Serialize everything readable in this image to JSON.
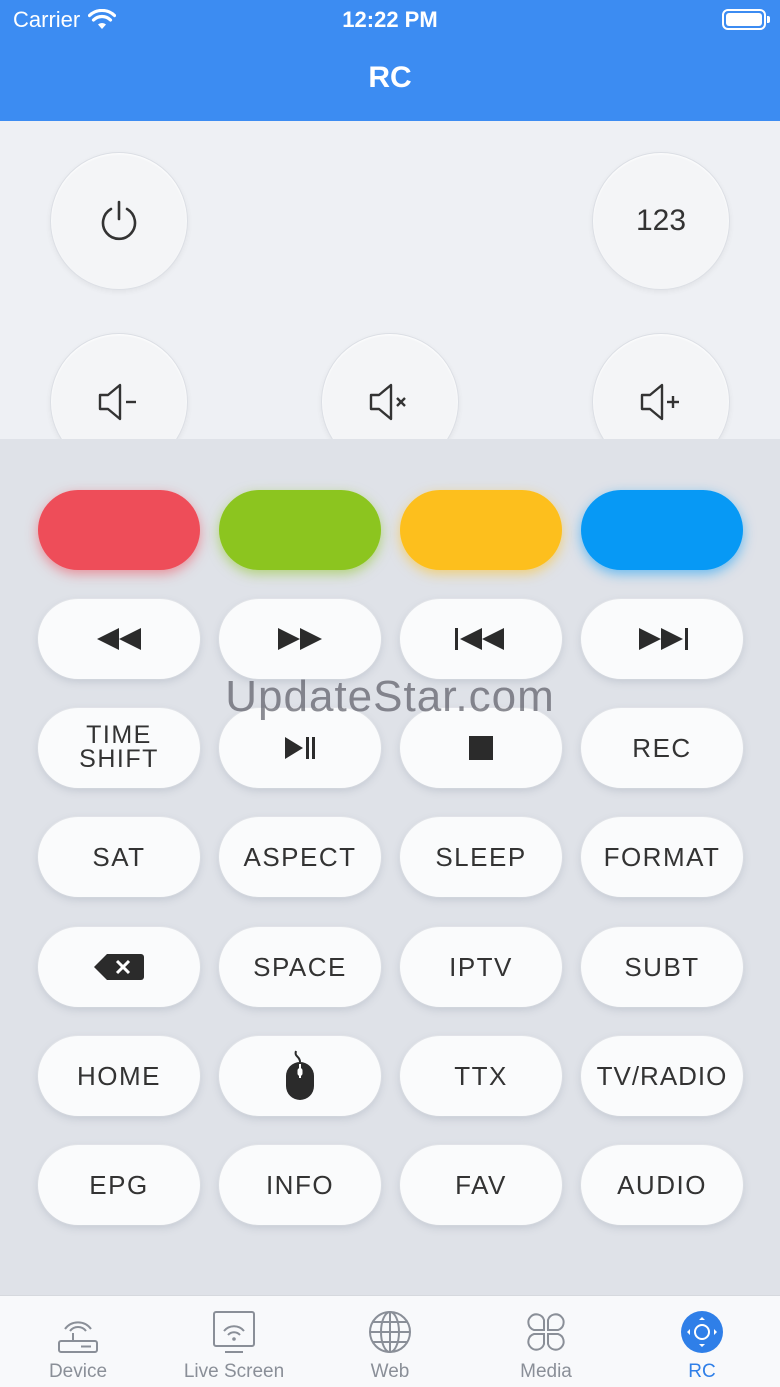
{
  "status_bar": {
    "carrier": "Carrier",
    "time": "12:22 PM"
  },
  "header": {
    "title": "RC"
  },
  "top_buttons": {
    "power_icon": "power-icon",
    "numpad_label": "123",
    "vol_down_icon": "volume-down-icon",
    "mute_icon": "mute-icon",
    "vol_up_icon": "volume-up-icon"
  },
  "colors": {
    "header": "#3c8cf2",
    "red": "#ee4d59",
    "green": "#8cc51f",
    "yellow": "#fdbf1d",
    "blue": "#0799f5",
    "active_tab": "#2f7fe8"
  },
  "transport": {
    "rewind_icon": "rewind-icon",
    "fast_forward_icon": "fast-forward-icon",
    "previous_icon": "skip-previous-icon",
    "next_icon": "skip-next-icon"
  },
  "row3": {
    "timeshift_line1": "TIME",
    "timeshift_line2": "SHIFT",
    "play_pause_icon": "play-pause-icon",
    "stop_icon": "stop-icon",
    "rec": "REC"
  },
  "row4": {
    "sat": "SAT",
    "aspect": "ASPECT",
    "sleep": "SLEEP",
    "format": "FORMAT"
  },
  "row5": {
    "backspace_icon": "backspace-icon",
    "space": "SPACE",
    "iptv": "IPTV",
    "subt": "SUBT"
  },
  "row6": {
    "home": "HOME",
    "mouse_icon": "mouse-icon",
    "ttx": "TTX",
    "tv_radio": "TV/RADIO"
  },
  "row7": {
    "epg": "EPG",
    "info": "INFO",
    "fav": "FAV",
    "audio": "AUDIO"
  },
  "watermark": "UpdateStar.com",
  "tabs": [
    {
      "label": "Device",
      "icon": "router-icon"
    },
    {
      "label": "Live Screen",
      "icon": "screen-cast-icon"
    },
    {
      "label": "Web",
      "icon": "globe-icon"
    },
    {
      "label": "Media",
      "icon": "media-grid-icon"
    },
    {
      "label": "RC",
      "icon": "remote-icon",
      "active": true
    }
  ]
}
